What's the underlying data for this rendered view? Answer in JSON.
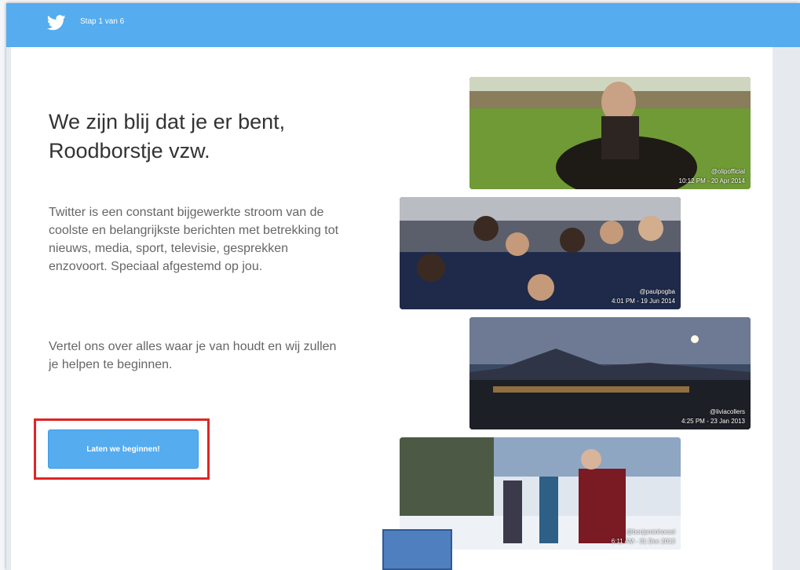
{
  "header": {
    "step_label": "Stap 1 van 6",
    "bird_icon": "twitter-bird-icon",
    "bar_color": "#55acee"
  },
  "welcome": {
    "headline": "We zijn blij dat je er bent, Roodborstje vzw.",
    "intro": "Twitter is een constant bijgewerkte stroom van de coolste en belangrijkste berichten met betrekking tot nieuws, media, sport, televisie, gesprekken enzovoort. Speciaal afgestemd op jou.",
    "intro2": "Vertel ons over alles waar je van houdt en wij zullen je helpen te beginnen.",
    "cta_label": "Laten we beginnen!",
    "highlight_color": "#e02424"
  },
  "photos": [
    {
      "handle": "@olipofficial",
      "timestamp": "10:12 PM - 20 Apr 2014"
    },
    {
      "handle": "@paulpogba",
      "timestamp": "4:01 PM - 19 Jun 2014"
    },
    {
      "handle": "@liviacollers",
      "timestamp": "4:25 PM - 23 Jan 2013"
    },
    {
      "handle": "@benjaminhorsel",
      "timestamp": "6:11 AM - 31 Dec 2013"
    }
  ]
}
